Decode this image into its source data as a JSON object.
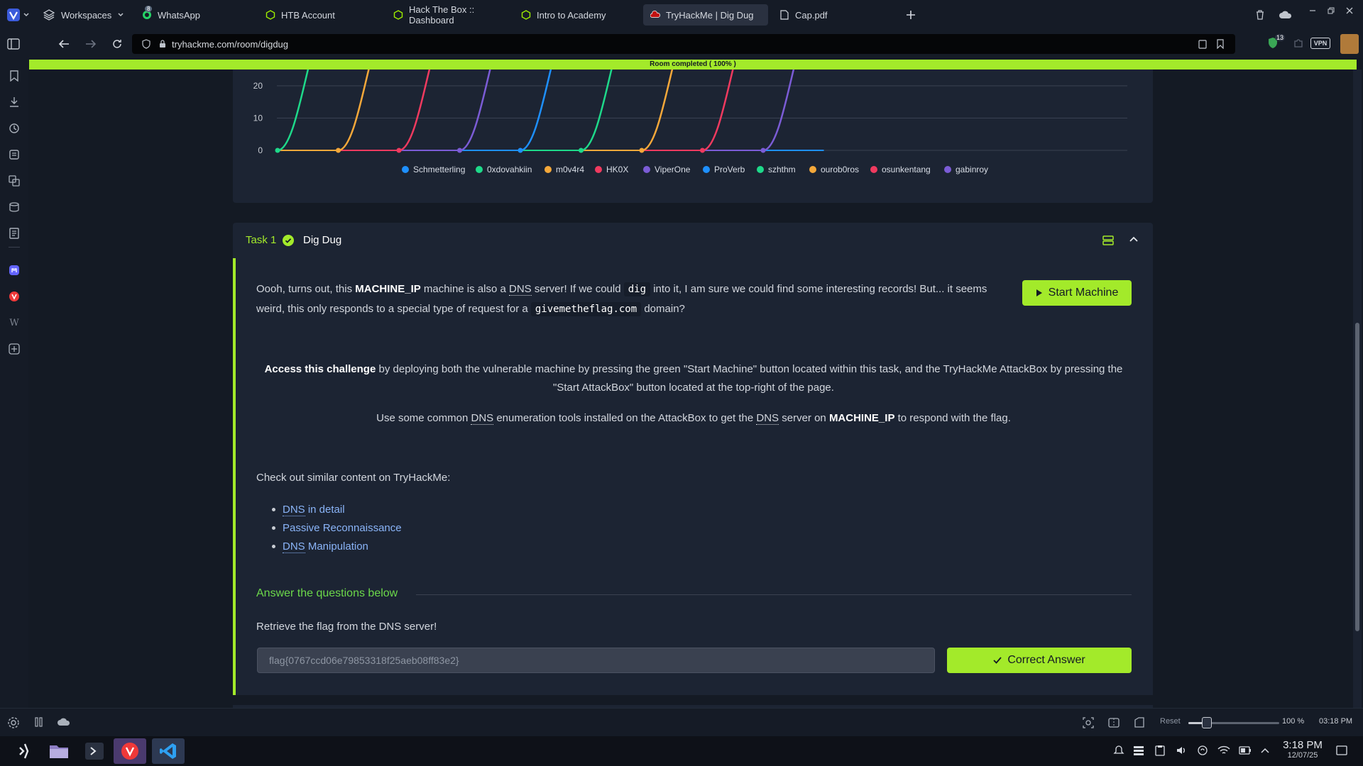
{
  "browser": {
    "workspaces_label": "Workspaces",
    "tabs": [
      {
        "label": "WhatsApp",
        "badge": "8"
      },
      {
        "label": "HTB Account"
      },
      {
        "label": "Hack The Box :: Dashboard"
      },
      {
        "label": "Intro to Academy"
      },
      {
        "label": "TryHackMe | Dig Dug"
      },
      {
        "label": "Cap.pdf"
      }
    ],
    "url": "tryhackme.com/room/digdug",
    "shield_badge": "13",
    "vpn_label": "VPN"
  },
  "progress": {
    "label": "Room completed ( 100% )",
    "value_percent": 100
  },
  "chart_data": {
    "type": "line",
    "y_ticks": [
      0,
      10,
      20
    ],
    "ylim_visible": [
      0,
      25
    ],
    "grid": true,
    "legend_position": "bottom-center",
    "series": [
      {
        "name": "Schmetterling",
        "color": "#1e90ff"
      },
      {
        "name": "0xdovahkiin",
        "color": "#1ed98a"
      },
      {
        "name": "m0v4r4",
        "color": "#f5a83a"
      },
      {
        "name": "HK0X",
        "color": "#f03a5f"
      },
      {
        "name": "ViperOne",
        "color": "#7b5cd6"
      },
      {
        "name": "ProVerb",
        "color": "#1e90ff"
      },
      {
        "name": "szhthm",
        "color": "#1ed98a"
      },
      {
        "name": "ourob0ros",
        "color": "#f5a83a"
      },
      {
        "name": "osunkentang",
        "color": "#f03a5f"
      },
      {
        "name": "gabinroy",
        "color": "#7b5cd6"
      }
    ]
  },
  "task": {
    "number_label": "Task 1",
    "title": "Dig Dug",
    "para1_a": "Oooh, turns out, this ",
    "machine_ip": "MACHINE_IP",
    "para1_b": " machine is also a ",
    "dns": "DNS",
    "para1_c": " server! If we could ",
    "dig_code": "dig",
    "para1_d": " into it, I am sure we could find some interesting records! But... it seems",
    "para1_e": "weird, this only responds to a special type of request for a ",
    "domain_code": "givemetheflag.com",
    "para1_f": " domain?",
    "start_machine_label": "Start Machine",
    "access_bold": "Access this challenge",
    "access_line1": " by deploying both the vulnerable machine by pressing the green \"Start Machine\" button located within this task, and the TryHackMe AttackBox by pressing the",
    "access_line2": "\"Start AttackBox\" button located at the top-right of the page.",
    "use_a": "Use some common ",
    "use_b": " enumeration tools installed on the AttackBox to get the ",
    "use_c": " server on ",
    "use_d": " to respond with the flag.",
    "similar_label": "Check out similar content on TryHackMe:",
    "links": [
      {
        "abbr": "DNS",
        "rest": " in detail"
      },
      {
        "abbr": "",
        "rest": "Passive Reconnaissance"
      },
      {
        "abbr": "DNS",
        "rest": " Manipulation"
      }
    ],
    "answer_heading": "Answer the questions below",
    "question": "Retrieve the flag from the DNS server!",
    "answer_value": "flag{0767ccd06e79853318f25aeb08ff83e2}",
    "correct_label": "Correct Answer"
  },
  "statusbar": {
    "reset_label": "Reset",
    "zoom": "100 %",
    "time": "03:18 PM",
    "zoom_percent": 100
  },
  "taskbar": {
    "time": "3:18 PM",
    "date": "12/07/25"
  }
}
